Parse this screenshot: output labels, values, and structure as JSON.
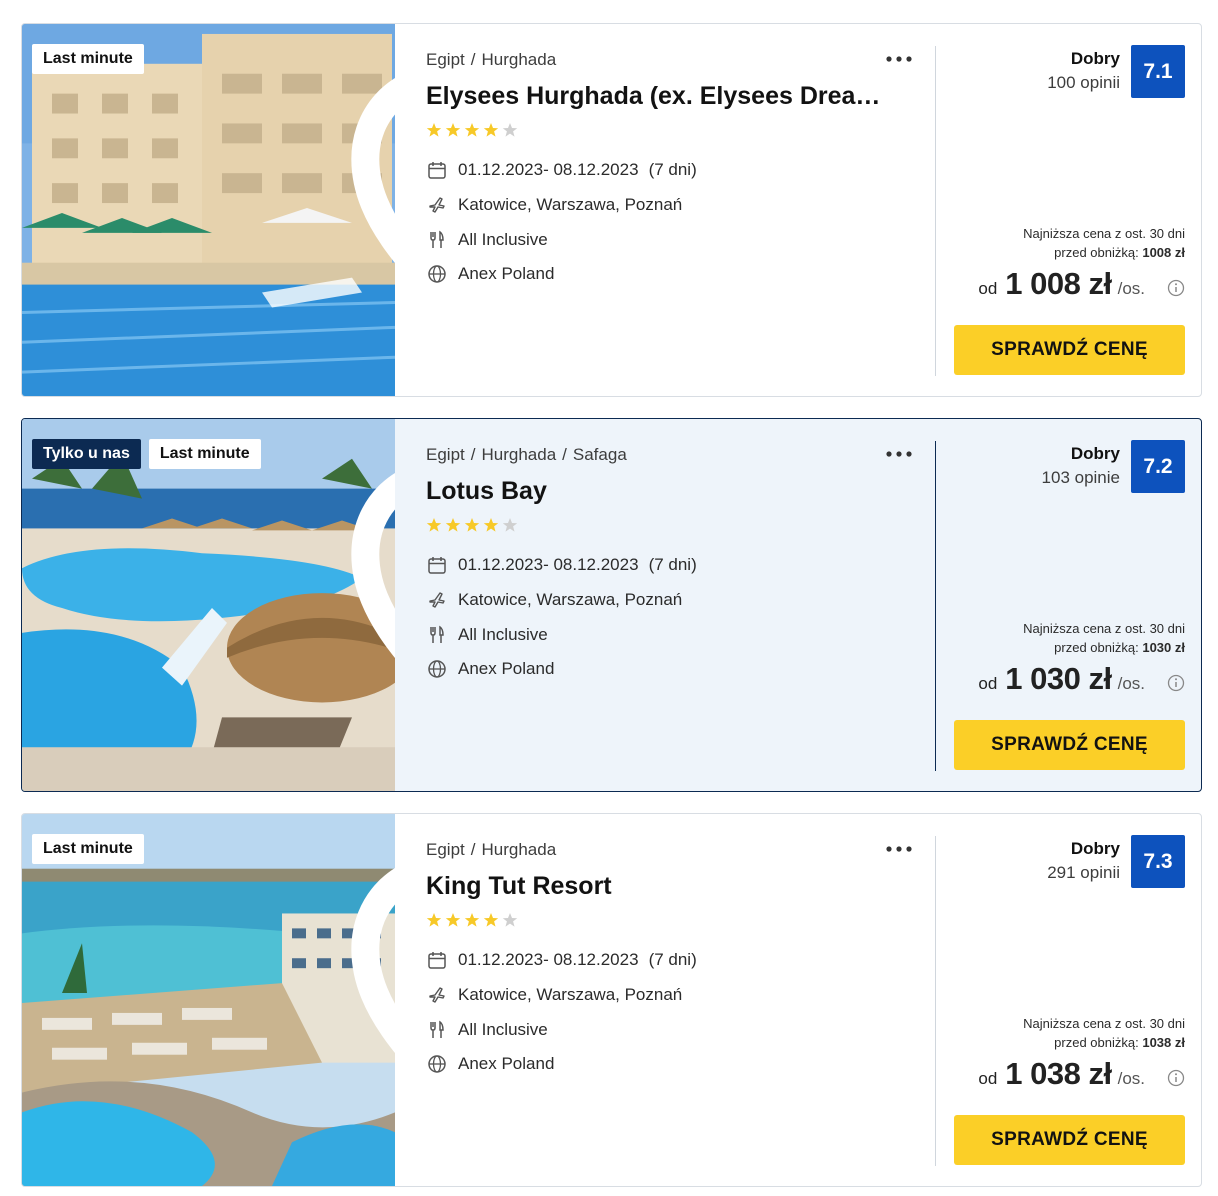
{
  "offers": [
    {
      "badges": [
        "Last minute"
      ],
      "breadcrumb": [
        "Egipt",
        "Hurghada"
      ],
      "name": "Elysees Hurghada (ex. Elysees Dream Beach)",
      "stars": 4,
      "stars_max": 5,
      "dates": "01.12.2023- 08.12.2023",
      "duration": "(7 dni)",
      "departures": "Katowice, Warszawa, Poznań",
      "board": "All Inclusive",
      "operator": "Anex Poland",
      "rating_label": "Dobry",
      "rating_count": "100 opinii",
      "score": "7.1",
      "lowest_line1": "Najniższa cena z ost. 30 dni",
      "lowest_line2_prefix": "przed obniżką:",
      "lowest_value": "1008 zł",
      "price_prefix": "od",
      "price": "1 008 zł",
      "price_suffix": "/os.",
      "cta": "SPRAWDŹ CENĘ"
    },
    {
      "badges": [
        "Tylko u nas",
        "Last minute"
      ],
      "breadcrumb": [
        "Egipt",
        "Hurghada",
        "Safaga"
      ],
      "name": "Lotus Bay",
      "stars": 4,
      "stars_max": 5,
      "dates": "01.12.2023- 08.12.2023",
      "duration": "(7 dni)",
      "departures": "Katowice, Warszawa, Poznań",
      "board": "All Inclusive",
      "operator": "Anex Poland",
      "rating_label": "Dobry",
      "rating_count": "103 opinie",
      "score": "7.2",
      "lowest_line1": "Najniższa cena z ost. 30 dni",
      "lowest_line2_prefix": "przed obniżką:",
      "lowest_value": "1030 zł",
      "price_prefix": "od",
      "price": "1 030 zł",
      "price_suffix": "/os.",
      "cta": "SPRAWDŹ CENĘ"
    },
    {
      "badges": [
        "Last minute"
      ],
      "breadcrumb": [
        "Egipt",
        "Hurghada"
      ],
      "name": "King Tut Resort",
      "stars": 4,
      "stars_max": 5,
      "dates": "01.12.2023- 08.12.2023",
      "duration": "(7 dni)",
      "departures": "Katowice, Warszawa, Poznań",
      "board": "All Inclusive",
      "operator": "Anex Poland",
      "rating_label": "Dobry",
      "rating_count": "291 opinii",
      "score": "7.3",
      "lowest_line1": "Najniższa cena z ost. 30 dni",
      "lowest_line2_prefix": "przed obniżką:",
      "lowest_value": "1038 zł",
      "price_prefix": "od",
      "price": "1 038 zł",
      "price_suffix": "/os.",
      "cta": "SPRAWDŹ CENĘ"
    }
  ],
  "colors": {
    "accent_yellow": "#fbcf27",
    "score_blue": "#0d52bd",
    "navy": "#0c2a52",
    "star": "#f7c928",
    "star_empty": "#cfcfcf"
  },
  "icons": {
    "favorite": "heart-icon",
    "more": "more-dots-icon",
    "dates": "calendar-icon",
    "departures": "plane-icon",
    "board": "cutlery-icon",
    "operator": "globe-icon",
    "price_info": "info-icon"
  }
}
